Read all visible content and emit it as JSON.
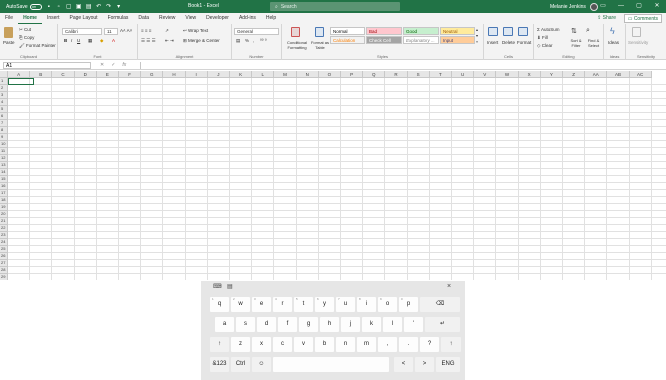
{
  "titlebar": {
    "autosave_label": "AutoSave",
    "autosave_state": "Off",
    "qat_icons": [
      "save-icon",
      "open-icon",
      "new-icon",
      "print-preview-icon",
      "print-icon",
      "undo-icon",
      "redo-icon",
      "customize-icon"
    ],
    "doc_title": "Book1 - Excel",
    "search_placeholder": "Search",
    "user_name": "Melanie Jenkins",
    "window_controls": [
      "ribbon-display-icon",
      "minimize-icon",
      "restore-icon",
      "close-icon"
    ]
  },
  "menu": {
    "tabs": [
      "File",
      "Home",
      "Insert",
      "Page Layout",
      "Formulas",
      "Data",
      "Review",
      "View",
      "Developer",
      "Add-ins",
      "Help"
    ],
    "active": "Home",
    "share": "Share",
    "comments": "Comments"
  },
  "ribbon": {
    "clipboard": {
      "paste": "Paste",
      "cut": "Cut",
      "copy": "Copy",
      "format_painter": "Format Painter",
      "label": "Clipboard"
    },
    "font": {
      "family": "Calibri",
      "size": "11",
      "bold": "B",
      "italic": "I",
      "underline": "U",
      "label": "Font"
    },
    "alignment": {
      "wrap": "Wrap Text",
      "merge": "Merge & Center",
      "label": "Alignment"
    },
    "number": {
      "format": "General",
      "percent": "%",
      "comma": ",",
      "label": "Number"
    },
    "styles": {
      "conditional": "Conditional Formatting",
      "format_table": "Format as Table",
      "cells": [
        {
          "name": "Normal",
          "bg": "#ffffff",
          "color": "#000000"
        },
        {
          "name": "Bad",
          "bg": "#ffc7ce",
          "color": "#9c0006"
        },
        {
          "name": "Good",
          "bg": "#c6efce",
          "color": "#006100"
        },
        {
          "name": "Neutral",
          "bg": "#ffeb9c",
          "color": "#9c5700"
        },
        {
          "name": "Calculation",
          "bg": "#f2f2f2",
          "color": "#fa7d00"
        },
        {
          "name": "Check Cell",
          "bg": "#a5a5a5",
          "color": "#ffffff"
        },
        {
          "name": "Explanatory ...",
          "bg": "#ffffff",
          "color": "#7f7f7f"
        },
        {
          "name": "Input",
          "bg": "#ffcc99",
          "color": "#3f3f76"
        }
      ],
      "label": "Styles"
    },
    "cells": {
      "insert": "Insert",
      "delete": "Delete",
      "format": "Format",
      "label": "Cells"
    },
    "editing": {
      "autosum": "AutoSum",
      "fill": "Fill",
      "clear": "Clear",
      "sort": "Sort & Filter",
      "find": "Find & Select",
      "label": "Editing"
    },
    "ideas": {
      "ideas": "Ideas",
      "label": "Ideas"
    },
    "sensitivity": {
      "sensitivity": "Sensitivity",
      "label": "Sensitivity"
    }
  },
  "formula_bar": {
    "name_box": "A1",
    "fx": "fx",
    "value": ""
  },
  "grid": {
    "columns": [
      "A",
      "B",
      "C",
      "D",
      "E",
      "F",
      "G",
      "H",
      "I",
      "J",
      "K",
      "L",
      "M",
      "N",
      "O",
      "P",
      "Q",
      "R",
      "S",
      "T",
      "U",
      "V",
      "W",
      "X",
      "Y",
      "Z",
      "AA",
      "AB",
      "AC"
    ],
    "rows": [
      "1",
      "2",
      "3",
      "4",
      "5",
      "6",
      "7",
      "8",
      "9",
      "10",
      "11",
      "12",
      "13",
      "14",
      "15",
      "16",
      "17",
      "18",
      "19",
      "20",
      "21",
      "22",
      "23",
      "24",
      "25",
      "26",
      "27",
      "28",
      "29"
    ],
    "selected": "A1"
  },
  "keyboard": {
    "toolbar": [
      "emoji-panel-icon",
      "clipboard-icon",
      "close-icon"
    ],
    "close_label": "×",
    "row1": [
      [
        "q",
        "1"
      ],
      [
        "w",
        "2"
      ],
      [
        "e",
        "3"
      ],
      [
        "r",
        "4"
      ],
      [
        "t",
        "5"
      ],
      [
        "y",
        "6"
      ],
      [
        "u",
        "7"
      ],
      [
        "i",
        "8"
      ],
      [
        "o",
        "9"
      ],
      [
        "p",
        "0"
      ]
    ],
    "backspace": "⌫",
    "row2": [
      "a",
      "s",
      "d",
      "f",
      "g",
      "h",
      "j",
      "k",
      "l",
      "'"
    ],
    "enter": "↵",
    "shift": "↑",
    "row3": [
      "z",
      "x",
      "c",
      "v",
      "b",
      "n",
      "m",
      ",",
      ".",
      "?"
    ],
    "shift_right": "↑",
    "bottom": {
      "sym": "&123",
      "ctrl": "Ctrl",
      "emoji": "☺",
      "left": "<",
      "right": ">",
      "lang": "ENG"
    }
  }
}
